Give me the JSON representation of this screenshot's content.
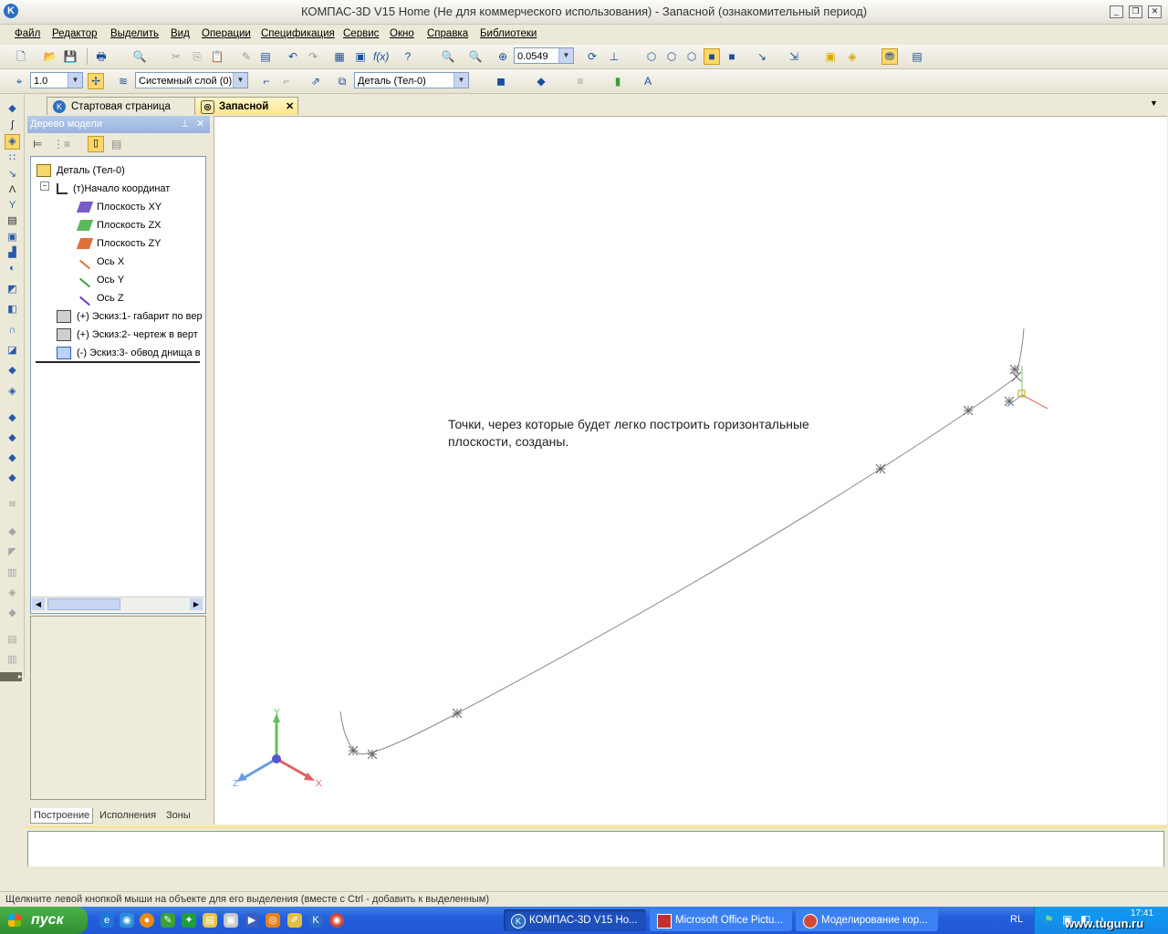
{
  "window": {
    "title": "КОМПАС-3D V15 Home (Не для коммерческого использования) - Запасной (ознакомительный период)"
  },
  "menu": [
    "Файл",
    "Редактор",
    "Выделить",
    "Вид",
    "Операции",
    "Спецификация",
    "Сервис",
    "Окно",
    "Справка",
    "Библиотеки"
  ],
  "toolbar1": {
    "zoom_value": "0.0549"
  },
  "toolbar2": {
    "scale_value": "1.0",
    "layer_value": "Системный слой (0)",
    "body_value": "Деталь (Тел-0)"
  },
  "tabs": [
    {
      "label": "Стартовая страница",
      "active": false
    },
    {
      "label": "Запасной",
      "active": true
    }
  ],
  "tree": {
    "header": "Дерево модели",
    "nodes": [
      {
        "label": "Деталь (Тел-0)",
        "icon": "part-icon"
      },
      {
        "label": "(т)Начало координат",
        "icon": "origin-icon"
      },
      {
        "label": "Плоскость XY",
        "icon": "plane-xy-icon",
        "color": "#7a5cc8"
      },
      {
        "label": "Плоскость ZX",
        "icon": "plane-zx-icon",
        "color": "#5cb85c"
      },
      {
        "label": "Плоскость ZY",
        "icon": "plane-zy-icon",
        "color": "#e0703a"
      },
      {
        "label": "Ось X",
        "icon": "axis-x-icon",
        "color": "#e0703a"
      },
      {
        "label": "Ось Y",
        "icon": "axis-y-icon",
        "color": "#3aa03a"
      },
      {
        "label": "Ось Z",
        "icon": "axis-z-icon",
        "color": "#6a3ac0"
      },
      {
        "label": "(+) Эскиз:1- габарит по вер",
        "icon": "sketch-icon"
      },
      {
        "label": "(+) Эскиз:2- чертеж в верт",
        "icon": "sketch-icon"
      },
      {
        "label": "(-) Эскиз:3- обвод днища в",
        "icon": "sketch-icon"
      }
    ],
    "bottom_tabs": [
      "Построение",
      "Исполнения",
      "Зоны"
    ]
  },
  "viewport": {
    "annotation": "Точки, через которые будет легко построить горизонтальные плоскости, созданы.",
    "axes": {
      "x": "X",
      "y": "Y",
      "z": "Z"
    }
  },
  "status_text": "Щелкните левой кнопкой мыши на объекте для его выделения (вместе с Ctrl - добавить к выделенным)",
  "taskbar": {
    "start_label": "пуск",
    "items": [
      "КОМПАС-3D V15 Ho...",
      "Microsoft Office Pictu...",
      "Моделирование кор..."
    ],
    "lang": "RL",
    "clock": "17:41",
    "watermark": "www.tugun.ru"
  }
}
